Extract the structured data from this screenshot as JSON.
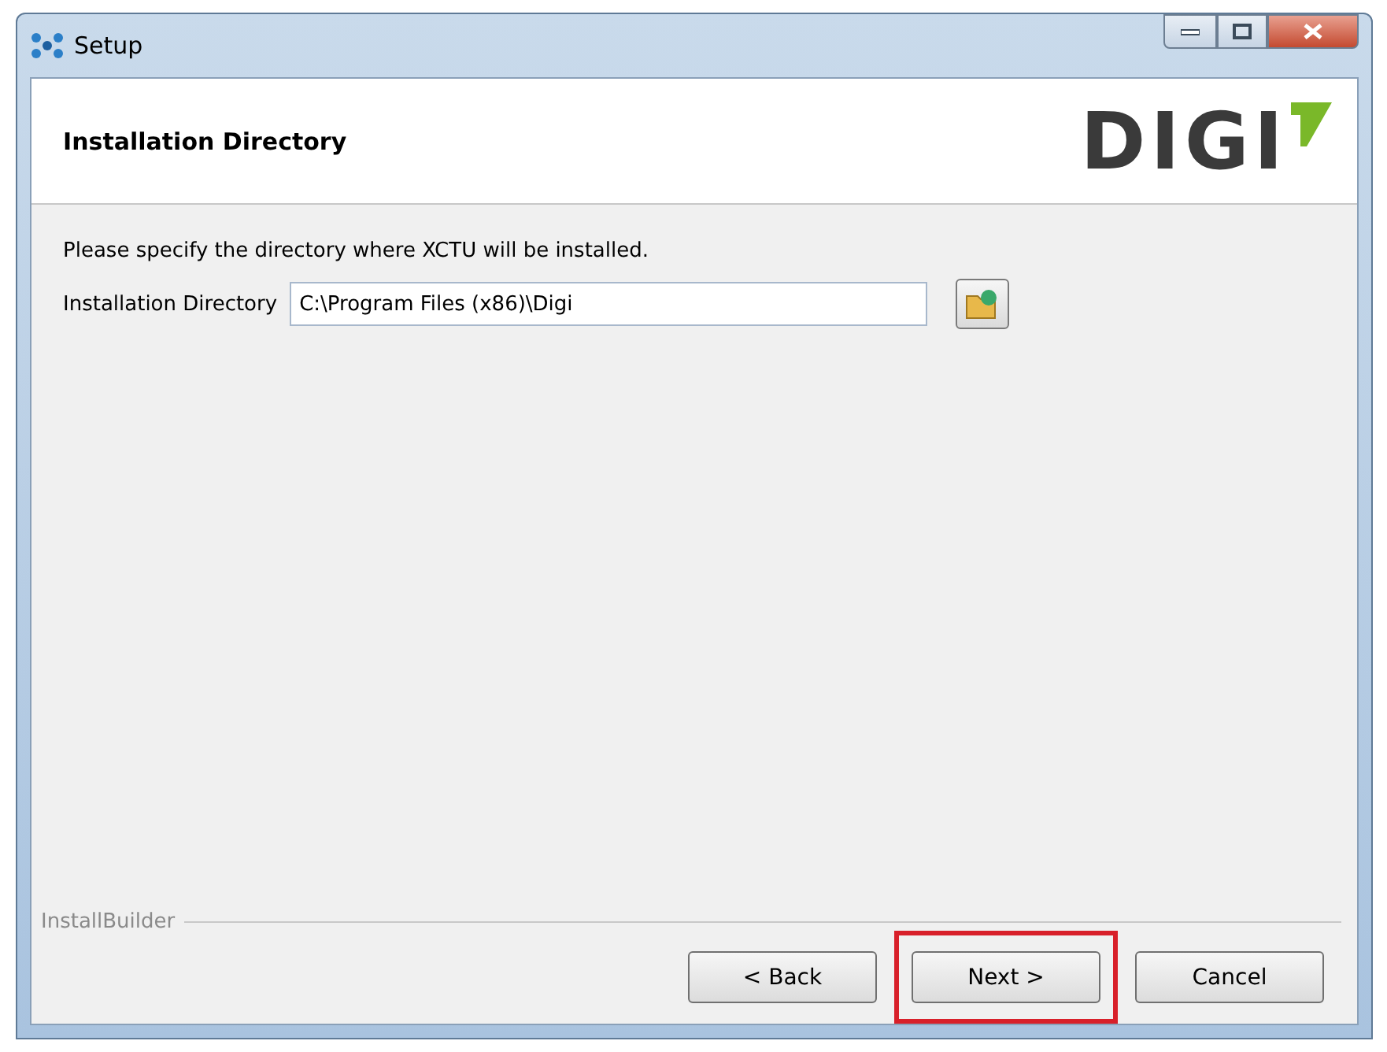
{
  "window": {
    "title": "Setup"
  },
  "header": {
    "title": "Installation Directory",
    "logo": "DIGI"
  },
  "body": {
    "prompt": "Please specify the directory where XCTU will be installed.",
    "field_label": "Installation Directory",
    "field_value": "C:\\Program Files (x86)\\Digi"
  },
  "footer": {
    "brand": "InstallBuilder"
  },
  "buttons": [
    {
      "label": "< Back",
      "highlighted": false
    },
    {
      "label": "Next >",
      "highlighted": true
    },
    {
      "label": "Cancel",
      "highlighted": false
    }
  ]
}
